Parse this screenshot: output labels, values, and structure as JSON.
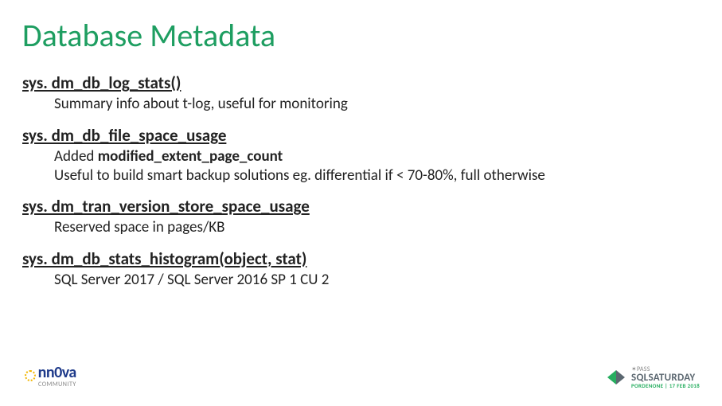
{
  "title": "Database Metadata",
  "items": [
    {
      "head": "sys. dm_db_log_stats()",
      "lines": [
        {
          "text": "Summary info about t-log, useful for monitoring"
        }
      ]
    },
    {
      "head": "sys. dm_db_file_space_usage",
      "lines": [
        {
          "prefix": "Added ",
          "bold": "modified_extent_page_count"
        },
        {
          "text": "Useful to build smart backup solutions eg. differential if < 70-80%, full otherwise"
        }
      ]
    },
    {
      "head": "sys. dm_tran_version_store_space_usage",
      "lines": [
        {
          "text": "Reserved space in pages/KB"
        }
      ]
    },
    {
      "head": "sys. dm_db_stats_histogram(object, stat)",
      "lines": [
        {
          "text": "SQL Server 2017 / SQL Server 2016 SP 1 CU 2"
        }
      ]
    }
  ],
  "footer": {
    "left": {
      "brand": "nn",
      "zero": "0",
      "brand2": "va",
      "sub": "COMMUNITY"
    },
    "right": {
      "pass": "PASS",
      "title": "SQLSATURDAY",
      "sub": "PORDENONE | 17 FEB 2018"
    }
  }
}
